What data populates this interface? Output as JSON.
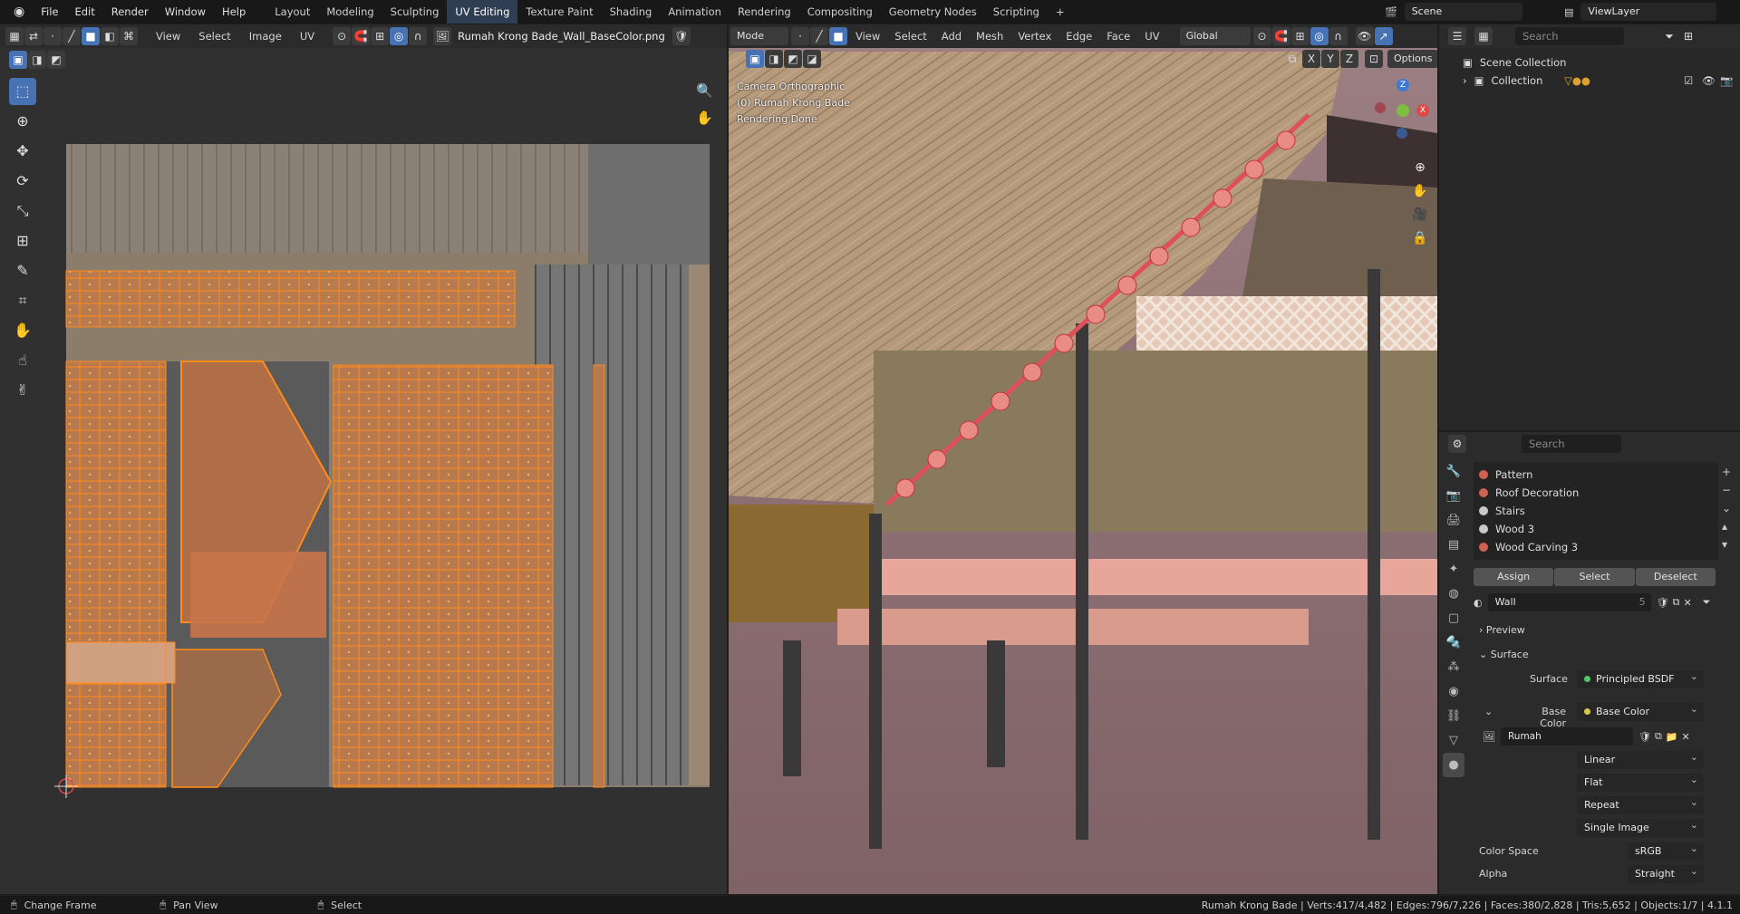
{
  "menu": [
    "File",
    "Edit",
    "Render",
    "Window",
    "Help"
  ],
  "workspaces": [
    "Layout",
    "Modeling",
    "Sculpting",
    "UV Editing",
    "Texture Paint",
    "Shading",
    "Animation",
    "Rendering",
    "Compositing",
    "Geometry Nodes",
    "Scripting"
  ],
  "active_workspace": "UV Editing",
  "add_workspace": "+",
  "scene": "Scene",
  "view_layer": "ViewLayer",
  "uv_editor": {
    "menus": [
      "View",
      "Select",
      "Image",
      "UV"
    ],
    "image_name": "Rumah Krong Bade_Wall_BaseColor.png"
  },
  "viewport": {
    "mode": "Mode",
    "menus": [
      "View",
      "Select",
      "Add",
      "Mesh",
      "Vertex",
      "Edge",
      "Face",
      "UV"
    ],
    "orientation": "Global",
    "axes": [
      "X",
      "Y",
      "Z"
    ],
    "options": "Options",
    "overlay_text": [
      "Camera Orthographic",
      "(0) Rumah Krong Bade",
      "Rendering Done"
    ],
    "gizmo": {
      "z": "Z",
      "x": "X"
    }
  },
  "outliner": {
    "search_placeholder": "Search",
    "scene_collection": "Scene Collection",
    "collection": "Collection"
  },
  "properties": {
    "search_placeholder": "Search",
    "materials": [
      {
        "name": "Pattern",
        "color": "#d06050"
      },
      {
        "name": "Roof Decoration",
        "color": "#d06050"
      },
      {
        "name": "Stairs",
        "color": "#c9c9c9"
      },
      {
        "name": "Wood 3",
        "color": "#c9c9c9"
      },
      {
        "name": "Wood Carving 3",
        "color": "#d06050"
      }
    ],
    "assign": "Assign",
    "select": "Select",
    "deselect": "Deselect",
    "material_name": "Wall",
    "users": "5",
    "preview": "Preview",
    "surface_section": "Surface",
    "surface_label": "Surface",
    "surface_value": "Principled BSDF",
    "base_color_label": "Base Color",
    "base_color_value": "Base Color",
    "texture_name": "Rumah Kron...BaseColor.png",
    "interpolation": "Linear",
    "projection": "Flat",
    "extension": "Repeat",
    "source": "Single Image",
    "color_space_label": "Color Space",
    "color_space": "sRGB",
    "alpha_label": "Alpha",
    "alpha": "Straight"
  },
  "status": {
    "change_frame": "Change Frame",
    "pan_view": "Pan View",
    "select": "Select",
    "stats": "Rumah Krong Bade | Verts:417/4,482 | Edges:796/7,226 | Faces:380/2,828 | Tris:5,652 | Objects:1/7 | 4.1.1"
  },
  "colors": {
    "accent": "#4772b3",
    "uv_orange": "#ff8c1a",
    "roof_select": "#e0505a"
  }
}
